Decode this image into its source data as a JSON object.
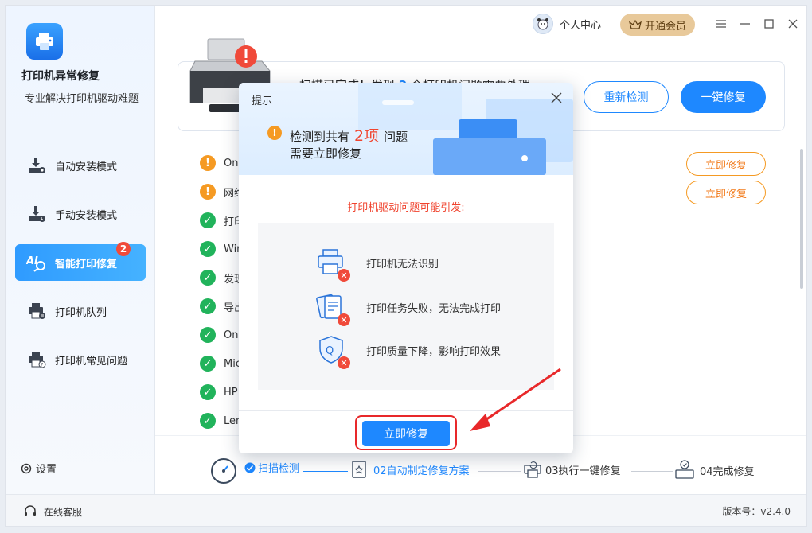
{
  "app": {
    "title": "打印机异常修复",
    "subtitle": "专业解决打印机驱动难题"
  },
  "sidebar": {
    "items": [
      {
        "label": "自动安装模式",
        "icon": "auto-install-icon"
      },
      {
        "label": "手动安装模式",
        "icon": "manual-install-icon"
      },
      {
        "label": "智能打印修复",
        "icon": "smart-repair-icon",
        "badge": "2",
        "active": true
      },
      {
        "label": "打印机队列",
        "icon": "printer-queue-icon"
      },
      {
        "label": "打印机常见问题",
        "icon": "printer-faq-icon"
      }
    ],
    "settings_label": "设置"
  },
  "topbar": {
    "user_center": "个人中心",
    "vip_label": "开通会员"
  },
  "banner": {
    "text_pre": "扫描已完成！发现",
    "count": "2",
    "text_post": "个打印机问题需要处理",
    "recheck_label": "重新检测",
    "onekey_label": "一键修复"
  },
  "issues": [
    {
      "label": "One",
      "status": "warn",
      "action": "立即修复"
    },
    {
      "label": "网络",
      "status": "warn",
      "action": "立即修复"
    },
    {
      "label": "打印",
      "status": "ok"
    },
    {
      "label": "Win",
      "status": "ok"
    },
    {
      "label": "发现",
      "status": "ok"
    },
    {
      "label": "导出",
      "status": "ok"
    },
    {
      "label": "One",
      "status": "ok"
    },
    {
      "label": "Mic",
      "status": "ok"
    },
    {
      "label": "HP",
      "status": "ok"
    },
    {
      "label": "Len",
      "status": "ok"
    }
  ],
  "steps": [
    {
      "label": "扫描检测",
      "state": "done"
    },
    {
      "label": "02自动制定修复方案",
      "state": "current"
    },
    {
      "label": "03执行一键修复",
      "state": "todo"
    },
    {
      "label": "04完成修复",
      "state": "todo"
    }
  ],
  "modal": {
    "title": "提示",
    "detect_pre": "检测到共有",
    "detect_count": "2项",
    "detect_post": "问题",
    "need_fix": "需要立即修复",
    "subtitle": "打印机驱动问题可能引发:",
    "effects": [
      {
        "label": "打印机无法识别",
        "icon": "printer-error-icon"
      },
      {
        "label": "打印任务失败，无法完成打印",
        "icon": "documents-error-icon"
      },
      {
        "label": "打印质量下降，影响打印效果",
        "icon": "quality-error-icon"
      }
    ],
    "fix_now_label": "立即修复"
  },
  "footer": {
    "online_service": "在线客服",
    "version": "版本号：v2.4.0"
  },
  "colors": {
    "primary": "#1e88ff",
    "warning": "#f59a23",
    "success": "#21b35b",
    "danger": "#f0442f",
    "vip": "#e8c99a"
  }
}
